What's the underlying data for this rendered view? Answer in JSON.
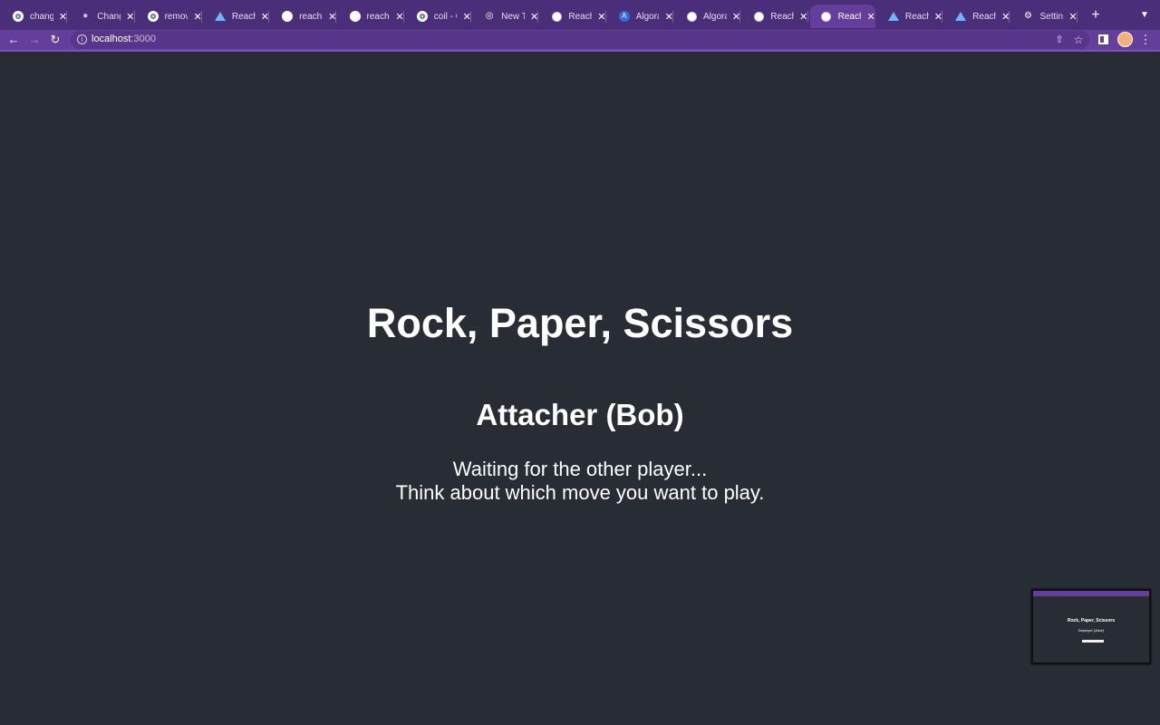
{
  "browser": {
    "tabs": [
      {
        "label": "change",
        "favicon": "google-icon"
      },
      {
        "label": "Change",
        "favicon": "apple-icon"
      },
      {
        "label": "remove",
        "favicon": "google-icon"
      },
      {
        "label": "Reach",
        "favicon": "reach-icon"
      },
      {
        "label": "reach-",
        "favicon": "github-icon"
      },
      {
        "label": "reach-",
        "favicon": "github-icon"
      },
      {
        "label": "coil - C",
        "favicon": "google-icon"
      },
      {
        "label": "New Ta",
        "favicon": "chrome-icon"
      },
      {
        "label": "Reach",
        "favicon": "globe-icon"
      },
      {
        "label": "Algorar",
        "favicon": "algorand-icon"
      },
      {
        "label": "Algorar",
        "favicon": "globe-icon"
      },
      {
        "label": "Reach",
        "favicon": "globe-icon"
      },
      {
        "label": "Reach",
        "favicon": "globe-icon",
        "active": true
      },
      {
        "label": "Reach",
        "favicon": "reach-icon"
      },
      {
        "label": "Reach",
        "favicon": "reach-icon"
      },
      {
        "label": "Setting",
        "favicon": "gear-icon"
      }
    ],
    "address": {
      "host": "localhost",
      "port": ":3000"
    },
    "colors": {
      "tabstrip": "#4a2e7a",
      "toolbar": "#653d9a",
      "page_background": "#282c34"
    }
  },
  "page": {
    "title": "Rock, Paper, Scissors",
    "subtitle": "Attacher (Bob)",
    "message_line1": "Waiting for the other player...",
    "message_line2": "Think about which move you want to play."
  },
  "thumbnail": {
    "title": "Rock, Paper, Scissors",
    "subtitle": "Deployer (Alice)"
  }
}
